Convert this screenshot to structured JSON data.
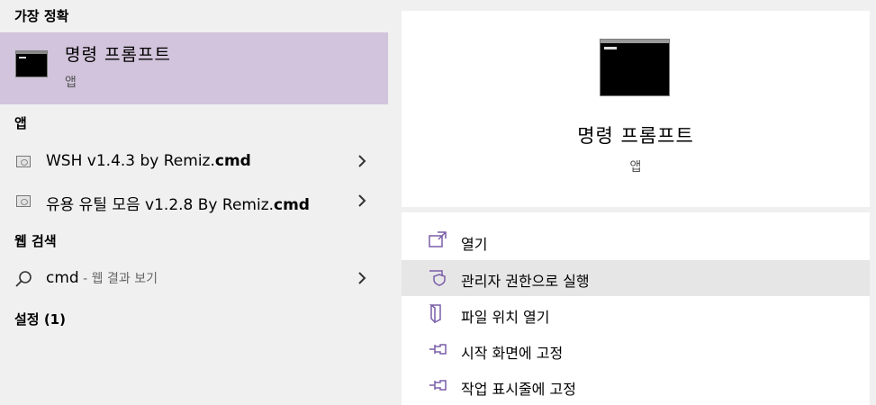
{
  "left": {
    "best_match_header": "가장 정확",
    "best_match": {
      "title": "명령 프롬프트",
      "subtitle": "앱"
    },
    "apps_header": "앱",
    "apps": [
      {
        "name_plain": "WSH v1.4.3 by Remiz.",
        "name_bold": "cmd"
      },
      {
        "name_plain": "유용 유틸 모음 v1.2.8 By Remiz.",
        "name_bold": "cmd"
      }
    ],
    "web_header": "웹 검색",
    "web_search": {
      "query": "cmd",
      "suffix": " - 웹 결과 보기"
    },
    "settings_header": "설정 (1)"
  },
  "right": {
    "app_title": "명령 프롬프트",
    "app_subtitle": "앱",
    "actions": [
      {
        "label": "열기",
        "icon": "open-icon"
      },
      {
        "label": "관리자 권한으로 실행",
        "icon": "shield-icon"
      },
      {
        "label": "파일 위치 열기",
        "icon": "file-location-icon"
      },
      {
        "label": "시작 화면에 고정",
        "icon": "pin-icon"
      },
      {
        "label": "작업 표시줄에 고정",
        "icon": "pin-icon"
      }
    ]
  },
  "colors": {
    "selection": "#d2c4dc",
    "accent": "#7a5ea8",
    "hover": "#e6e6e6"
  }
}
